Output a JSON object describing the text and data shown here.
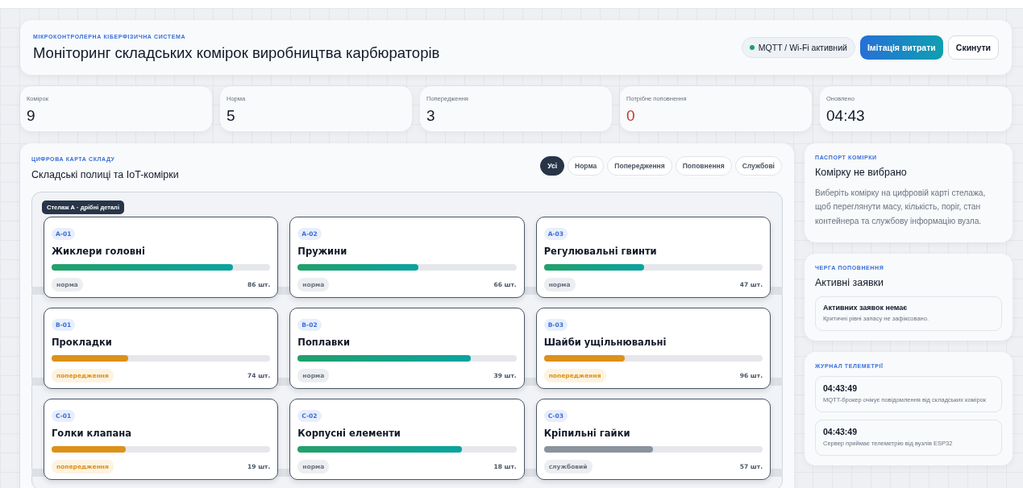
{
  "header": {
    "eyebrow": "МІКРОКОНТРОЛЕРНА КІБЕРФІЗИЧНА СИСТЕМА",
    "title": "Моніторинг складських комірок виробництва карбюраторів",
    "connection": {
      "label": "MQTT / Wi-Fi активний",
      "online": true
    },
    "buttons": [
      {
        "label": "Імітація витрати",
        "kind": "primary"
      },
      {
        "label": "Скинути",
        "kind": "secondary"
      }
    ]
  },
  "stats": [
    {
      "label": "Комірок",
      "value": "9",
      "alert": false
    },
    {
      "label": "Норма",
      "value": "5",
      "alert": false
    },
    {
      "label": "Попередження",
      "value": "3",
      "alert": false
    },
    {
      "label": "Потрібне поповнення",
      "value": "0",
      "alert": true
    },
    {
      "label": "Оновлено",
      "value": "04:43",
      "alert": false
    }
  ],
  "warehouse": {
    "eyebrow": "ЦИФРОВА КАРТА СКЛАДУ",
    "title": "Складські полиці та IoT-комірки",
    "filters": [
      {
        "label": "Усі",
        "selected": true
      },
      {
        "label": "Норма",
        "selected": false
      },
      {
        "label": "Попередження",
        "selected": false
      },
      {
        "label": "Поповнення",
        "selected": false
      },
      {
        "label": "Службові",
        "selected": false
      }
    ],
    "rack_label": "Стелаж А · дрібні деталі",
    "shelves": [
      {
        "cells": [
          {
            "code": "A-01",
            "name": "Жиклери головні",
            "level": 0.83,
            "status": "норма",
            "kind": "norm",
            "count": "86 шт."
          },
          {
            "code": "A-02",
            "name": "Пружини",
            "level": 0.55,
            "status": "норма",
            "kind": "norm",
            "count": "66 шт."
          },
          {
            "code": "A-03",
            "name": "Регулювальні гвинти",
            "level": 0.46,
            "status": "норма",
            "kind": "norm",
            "count": "47 шт."
          }
        ]
      },
      {
        "cells": [
          {
            "code": "B-01",
            "name": "Прокладки",
            "level": 0.35,
            "status": "попередження",
            "kind": "warning",
            "count": "74 шт."
          },
          {
            "code": "B-02",
            "name": "Поплавки",
            "level": 0.79,
            "status": "норма",
            "kind": "norm",
            "count": "39 шт."
          },
          {
            "code": "B-03",
            "name": "Шайби ущільнювальні",
            "level": 0.37,
            "status": "попередження",
            "kind": "warning",
            "count": "96 шт."
          }
        ]
      },
      {
        "cells": [
          {
            "code": "C-01",
            "name": "Голки клапана",
            "level": 0.34,
            "status": "попередження",
            "kind": "warning",
            "count": "19 шт."
          },
          {
            "code": "C-02",
            "name": "Корпусні елементи",
            "level": 0.75,
            "status": "норма",
            "kind": "norm",
            "count": "18 шт."
          },
          {
            "code": "C-03",
            "name": "Кріпильні гайки",
            "level": 0.5,
            "status": "службовий",
            "kind": "service",
            "count": "57 шт."
          }
        ]
      }
    ]
  },
  "passport": {
    "eyebrow": "ПАСПОРТ КОМІРКИ",
    "title": "Комірку не вибрано",
    "text": "Виберіть комірку на цифровій карті стелажа, щоб переглянути масу, кількість, поріг, стан контейнера та службову інформацію вузла."
  },
  "queue": {
    "eyebrow": "ЧЕРГА ПОПОВНЕННЯ",
    "title": "Активні заявки",
    "empty_title": "Активних заявок немає",
    "empty_text": "Критичні рівні запасу не зафіксовано."
  },
  "telemetry": {
    "eyebrow": "ЖУРНАЛ ТЕЛЕМЕТРІЇ",
    "entries": [
      {
        "time": "04:43:49",
        "message": "MQTT-брокер очікує повідомлення від складських комірок"
      },
      {
        "time": "04:43:49",
        "message": "Сервер приймає телеметрію від вузлів ESP32"
      }
    ]
  }
}
